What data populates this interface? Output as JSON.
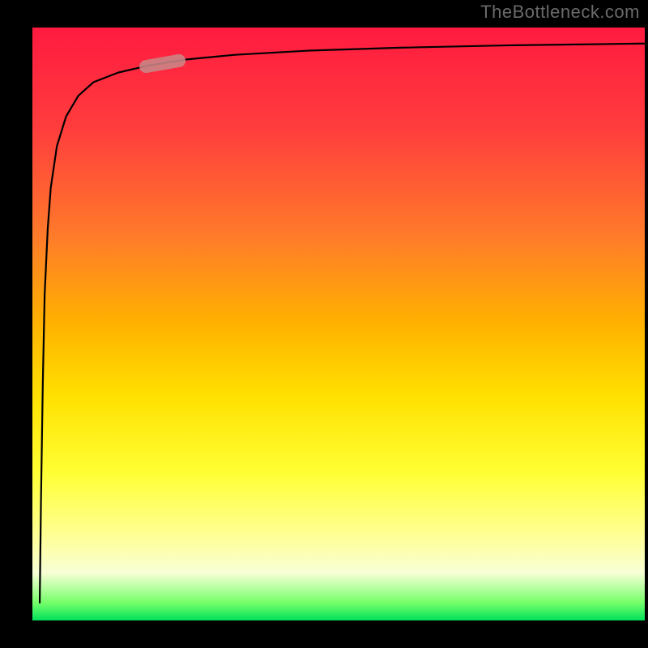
{
  "watermark": "TheBottleneck.com",
  "colors": {
    "frame": "#000000",
    "watermark_text": "#6a6a6a",
    "curve_stroke": "#000000",
    "marker_fill": "#c98686",
    "gradient_top": "#ff1a40",
    "gradient_bottom": "#00e05a"
  },
  "chart_data": {
    "type": "line",
    "title": "",
    "xlabel": "",
    "ylabel": "",
    "xlim": [
      0,
      100
    ],
    "ylim": [
      0,
      100
    ],
    "grid": false,
    "legend": false,
    "note": "Axes are hidden; values are in percent of plot width/height, origin at bottom-left. Curve resembles a steep logarithmic/asymptotic rise.",
    "series": [
      {
        "name": "bottleneck-curve",
        "x": [
          1.2,
          1.4,
          1.7,
          2.0,
          2.5,
          3.0,
          4.0,
          5.5,
          7.5,
          10,
          14,
          19,
          25,
          33,
          45,
          60,
          78,
          100
        ],
        "values": [
          3,
          20,
          40,
          55,
          66,
          73,
          80,
          85,
          88.5,
          90.8,
          92.4,
          93.6,
          94.6,
          95.4,
          96.1,
          96.6,
          97.0,
          97.3
        ]
      }
    ],
    "marker": {
      "description": "pink rounded segment highlighting a short span of the curve",
      "x_range_pct": [
        17.5,
        25
      ],
      "center_y_pct": 93.0
    },
    "background_gradient": {
      "direction": "top-to-bottom",
      "stops": [
        {
          "pct": 0,
          "color": "#ff1a40"
        },
        {
          "pct": 17,
          "color": "#ff3d3d"
        },
        {
          "pct": 35,
          "color": "#ff7a2a"
        },
        {
          "pct": 50,
          "color": "#ffb200"
        },
        {
          "pct": 62,
          "color": "#ffe000"
        },
        {
          "pct": 75,
          "color": "#ffff33"
        },
        {
          "pct": 86,
          "color": "#ffff99"
        },
        {
          "pct": 92,
          "color": "#f7ffd6"
        },
        {
          "pct": 97,
          "color": "#76ff6a"
        },
        {
          "pct": 100,
          "color": "#00e05a"
        }
      ]
    }
  }
}
